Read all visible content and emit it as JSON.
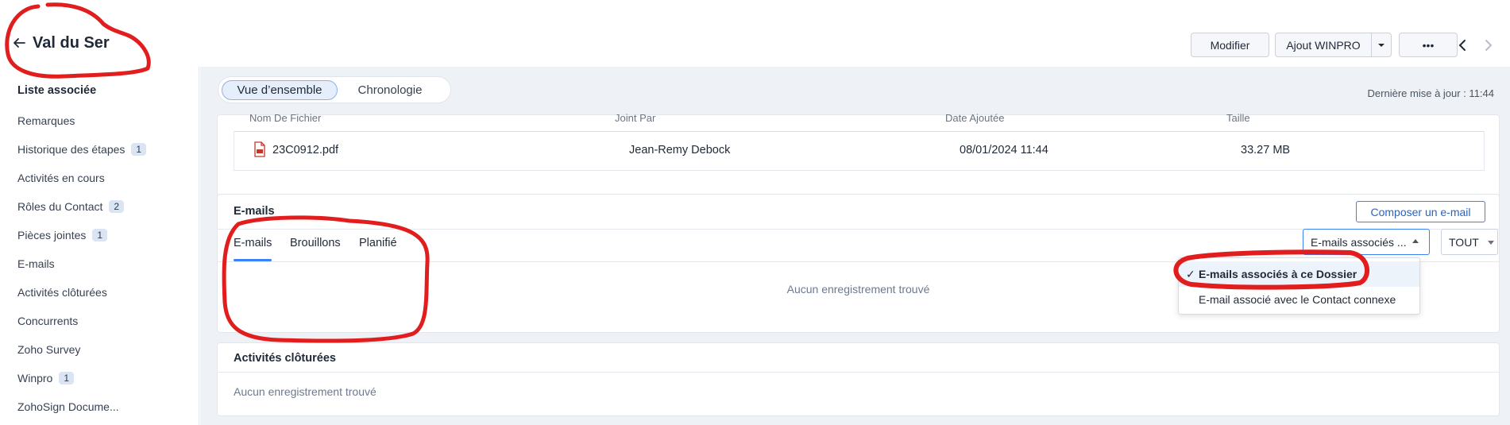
{
  "header": {
    "title": "Val du Ser",
    "buttons": {
      "modifier": "Modifier",
      "ajout": "Ajout WINPRO",
      "more": "•••"
    }
  },
  "sidebar": {
    "heading": "Liste associée",
    "items": [
      {
        "label": "Remarques",
        "badge": ""
      },
      {
        "label": "Historique des étapes",
        "badge": "1"
      },
      {
        "label": "Activités en cours",
        "badge": ""
      },
      {
        "label": "Rôles du Contact",
        "badge": "2"
      },
      {
        "label": "Pièces jointes",
        "badge": "1"
      },
      {
        "label": "E-mails",
        "badge": ""
      },
      {
        "label": "Activités clôturées",
        "badge": ""
      },
      {
        "label": "Concurrents",
        "badge": ""
      },
      {
        "label": "Zoho Survey",
        "badge": ""
      },
      {
        "label": "Winpro",
        "badge": "1"
      },
      {
        "label": "ZohoSign Docume...",
        "badge": ""
      }
    ]
  },
  "main": {
    "tabs": {
      "overview": "Vue d’ensemble",
      "chronology": "Chronologie"
    },
    "last_update": "Dernière mise à jour : 11:44",
    "attachments": {
      "columns": [
        "Nom De Fichier",
        "Joint Par",
        "Date Ajoutée",
        "Taille"
      ],
      "rows": [
        {
          "file": "23C0912.pdf",
          "by": "Jean-Remy Debock",
          "date": "08/01/2024 11:44",
          "size": "33.27 MB"
        }
      ]
    },
    "emails": {
      "title": "E-mails",
      "compose": "Composer un e-mail",
      "tabs": [
        "E-mails",
        "Brouillons",
        "Planifié"
      ],
      "filter_value": "E-mails associés ...",
      "scope_value": "TOUT",
      "empty": "Aucun enregistrement trouvé",
      "dropdown": [
        {
          "label": "E-mails associés à ce Dossier",
          "check": "✓"
        },
        {
          "label": "E-mail associé avec le Contact connexe",
          "check": ""
        }
      ]
    },
    "closed_activities": {
      "title": "Activités clôturées",
      "empty": "Aucun enregistrement trouvé"
    }
  },
  "colors": {
    "accent": "#3b82f6",
    "annotation": "#e11d1d"
  }
}
